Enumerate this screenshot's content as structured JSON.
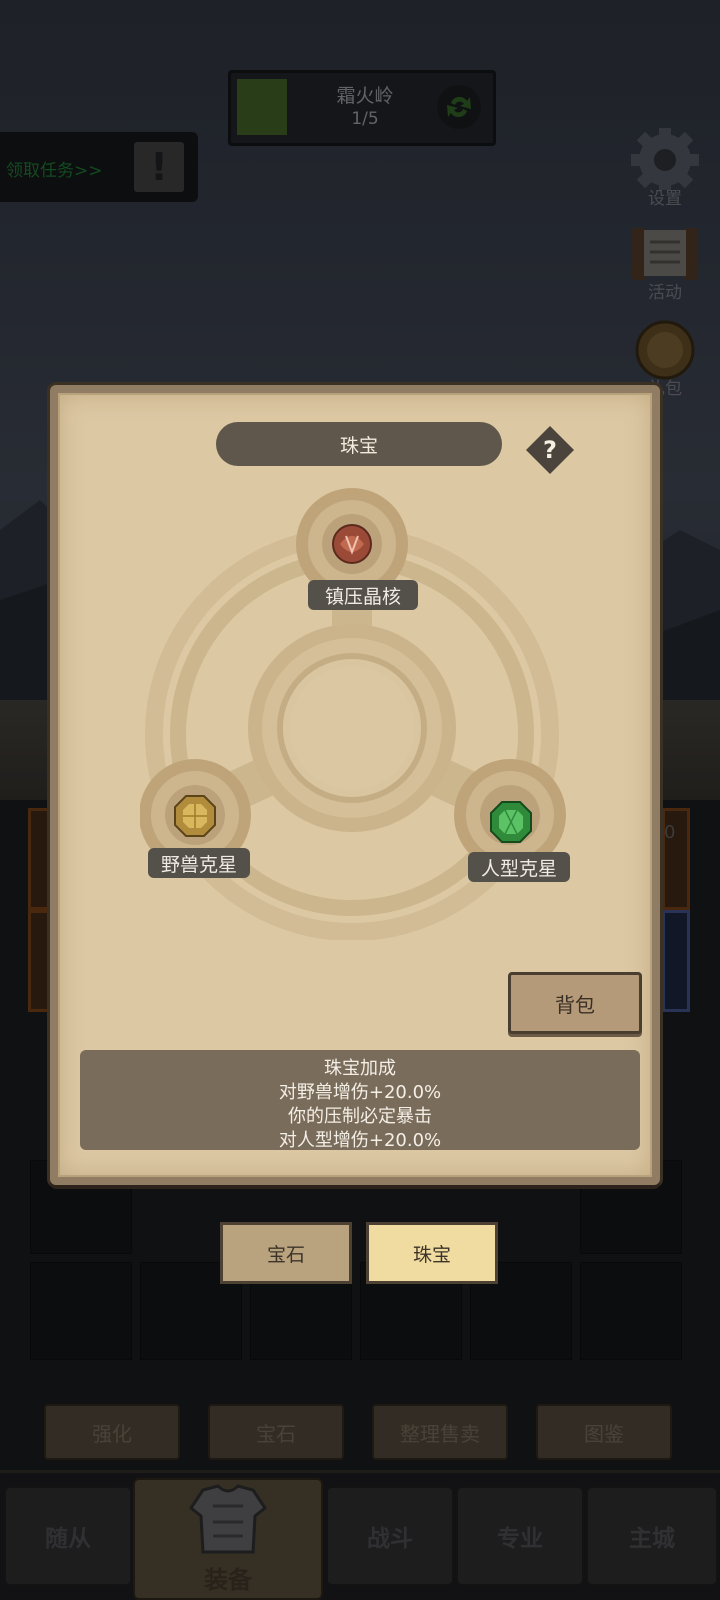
{
  "stage": {
    "name": "霜火岭",
    "progress": "1/5"
  },
  "quest": {
    "label": "领取任务>>",
    "alert": "!"
  },
  "side_menu": [
    {
      "label": "设置",
      "icon": "gear-icon"
    },
    {
      "label": "活动",
      "icon": "scroll-icon"
    },
    {
      "label": "礼包",
      "icon": "gift-icon"
    }
  ],
  "dialog": {
    "title": "珠宝",
    "help": "?",
    "sockets": {
      "top": {
        "label": "镇压晶核",
        "gem": "red-gem-icon"
      },
      "left": {
        "label": "野兽克星",
        "gem": "yellow-gem-icon"
      },
      "right": {
        "label": "人型克星",
        "gem": "green-gem-icon"
      }
    },
    "bag_button": "背包",
    "bonus": {
      "title": "珠宝加成",
      "lines": [
        "对野兽增伤+20.0%",
        "你的压制必定暴击",
        "对人型增伤+20.0%"
      ]
    }
  },
  "tabs": [
    {
      "label": "宝石",
      "active": false
    },
    {
      "label": "珠宝",
      "active": true
    }
  ],
  "bottom_actions": [
    "强化",
    "宝石",
    "整理售卖",
    "图鉴"
  ],
  "nav": [
    "随从",
    "装备",
    "战斗",
    "专业",
    "主城"
  ],
  "side_count": "0",
  "colors": {
    "panel": "#dcc8a3",
    "accent_active_tab": "#f0dca0",
    "quest_text": "#1e6b2e"
  }
}
